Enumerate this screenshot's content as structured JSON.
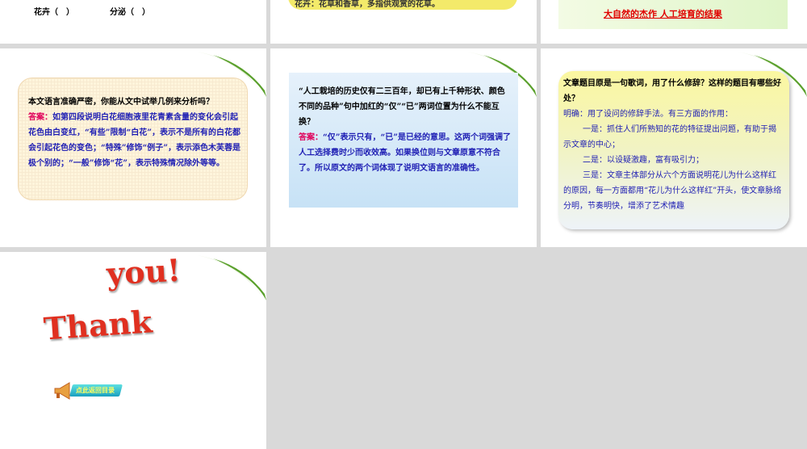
{
  "slide1": {
    "left_label": "花卉（　）",
    "right_label": "分泌（　）"
  },
  "slide2": {
    "partial_text": "花卉：花草和香草，多指供观赏的花草。"
  },
  "slide3": {
    "underlined": "大自然的杰作 人工培育的结果"
  },
  "slide4": {
    "question": "本文语言准确严密，你能从文中试举几例来分析吗？",
    "answer_label": "答案：",
    "answer": "如第四段说明白花细胞液里花青素含量的变化会引起花色由白变红，“有些”限制“白花”，表示不是所有的白花都会引起花色的变色；“特殊”修饰“例子”，表示添色木芙蓉是极个别的；“一般”修饰“花”，表示特殊情况除外等等。"
  },
  "slide5": {
    "question": "“人工栽培的历史仅有二三百年，却已有上千种形状、颜色不同的品种”句中加红的“仅”“已”两词位置为什么不能互换？",
    "answer_label": "答案：",
    "answer": "“仅”表示只有，“已”是已经的意思。这两个词强调了人工选择费时少而收效高。如果换位则与文章原意不符合了。所以原文的两个词体现了说明文语言的准确性。"
  },
  "slide6": {
    "question": "文章题目原是一句歌词，用了什么修辞？这样的题目有哪些好处？",
    "a1": "明确：用了设问的修辞手法。有三方面的作用：",
    "a2": "一是：抓住人们所熟知的花的特征提出问题，有助于揭示文章的中心；",
    "a3": "二是：以设疑激趣，富有吸引力；",
    "a4": "三是：文章主体部分从六个方面说明花儿为什么这样红的原因，每一方面都用“花儿为什么这样红”开头，使文章脉络分明，节奏明快，增添了艺术情趣"
  },
  "slide7": {
    "word1": "you!",
    "word2": "Thank",
    "back_button": "点此返回目录"
  }
}
